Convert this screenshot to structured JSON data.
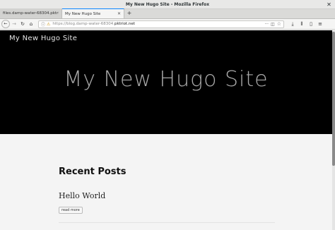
{
  "window": {
    "title": "My New Hugo Site - Mozilla Firefox"
  },
  "tabs": [
    {
      "label": "files.damp-water-68304.pktriot...",
      "active": false
    },
    {
      "label": "My New Hugo Site",
      "active": true
    }
  ],
  "navbar": {
    "url_prefix": "https://blog.damp-water-68304.",
    "url_domain": "pktriot.net"
  },
  "page": {
    "site_link": "My New Hugo Site",
    "hero_title": "My New Hugo Site",
    "recent_heading": "Recent Posts",
    "posts": [
      {
        "title": "Hello World",
        "read_more": "read more"
      }
    ]
  },
  "colors": {
    "hero_bg": "#000000",
    "tab_accent": "#0a84ff"
  }
}
